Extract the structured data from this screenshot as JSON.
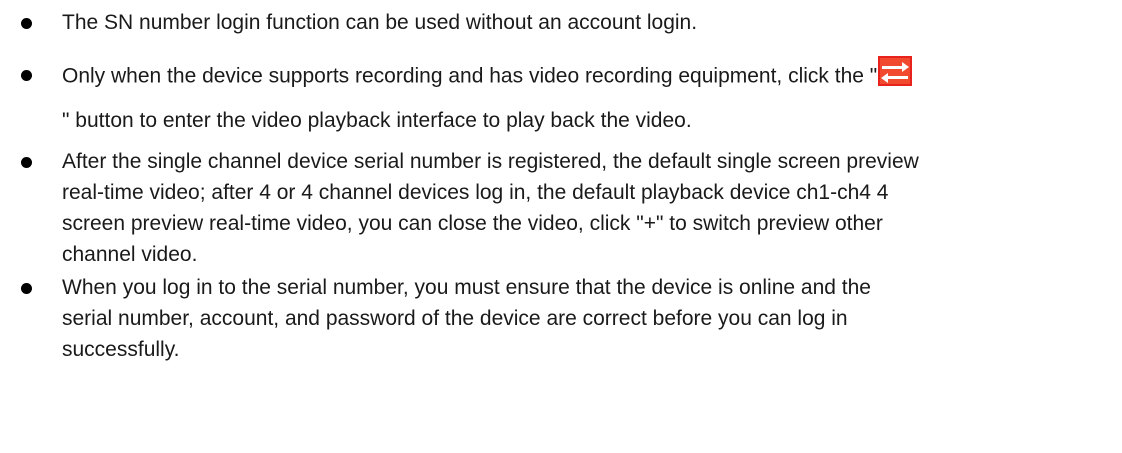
{
  "bullets": [
    {
      "lines": [
        "The SN number login function can be used without an account login."
      ]
    },
    {
      "lines": [
        "Only when the device supports recording and has video recording equipment, click the \"",
        "\" button to enter the video playback interface to play back the video."
      ],
      "icon": "playback-switch-icon",
      "icon_color": "#e8231d"
    },
    {
      "lines": [
        "After the single channel device serial number is registered, the default single screen preview",
        "real-time video; after 4 or 4 channel devices log in, the default playback device ch1-ch4 4",
        "screen preview real-time video, you can close the video, click \"+\" to switch preview other",
        "channel video."
      ]
    },
    {
      "lines": [
        "When you log in to the serial number, you must ensure that the device is online and the",
        "serial number, account, and password of the device are correct before you can log in",
        "successfully."
      ]
    }
  ]
}
